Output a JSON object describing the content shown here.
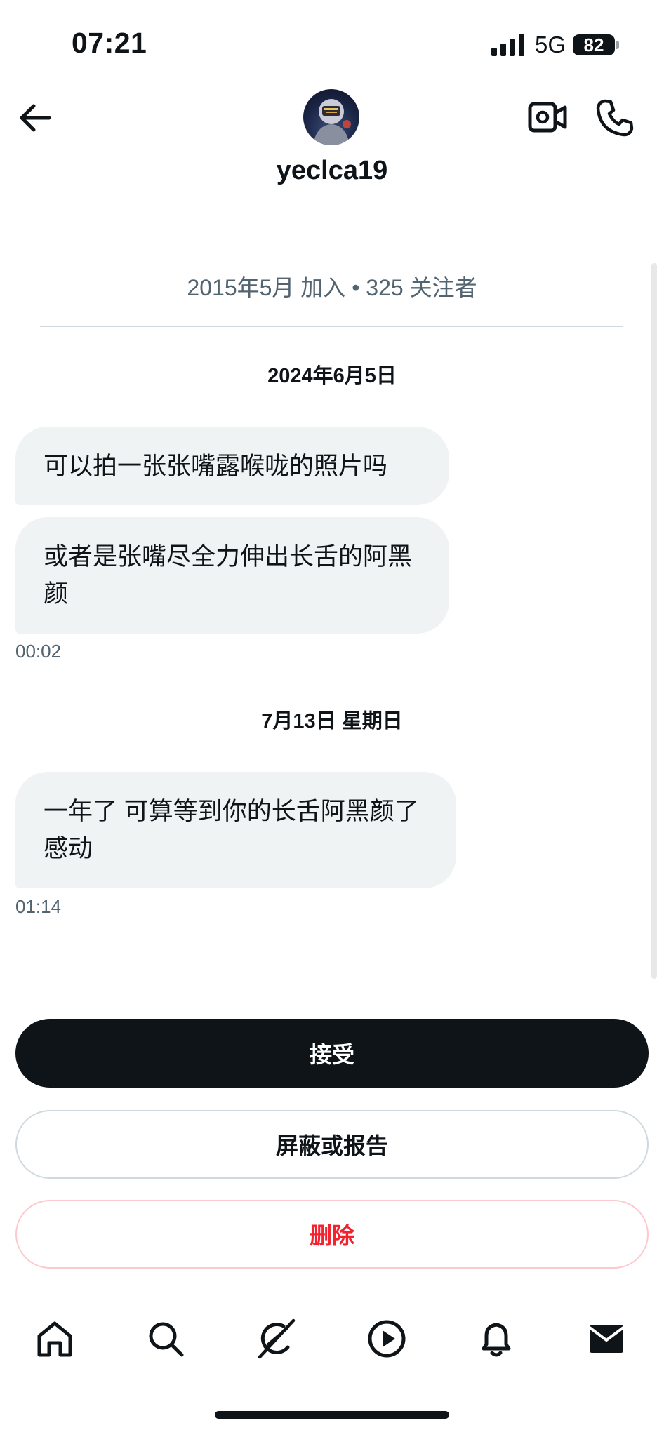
{
  "status_bar": {
    "time": "07:21",
    "network": "5G",
    "battery": "82"
  },
  "header": {
    "username": "yeclca19",
    "joined_info": "2015年5月 加入 • 325 关注者"
  },
  "conversation": [
    {
      "date": "2024年6月5日",
      "messages": [
        {
          "text": "可以拍一张张嘴露喉咙的照片吗"
        },
        {
          "text": "或者是张嘴尽全力伸出长舌的阿黑颜",
          "time": "00:02"
        }
      ]
    },
    {
      "date": "7月13日 星期日",
      "messages": [
        {
          "text": "一年了 可算等到你的长舌阿黑颜了 感动",
          "time": "01:14"
        }
      ]
    }
  ],
  "actions": {
    "accept": "接受",
    "block_or_report": "屏蔽或报告",
    "delete": "删除"
  },
  "colors": {
    "primary_text": "#0f1419",
    "secondary_text": "#536471",
    "bubble_bg": "#eff3f4",
    "accept_bg": "#0f1419",
    "delete_text": "#f4212e",
    "delete_border": "#fdc9ce",
    "border": "#cfd9de"
  },
  "icons": {
    "back": "arrow-left-icon",
    "video": "video-camera-icon",
    "call": "phone-icon",
    "nav": [
      "home-icon",
      "search-icon",
      "grok-icon",
      "play-icon",
      "bell-icon",
      "mail-icon"
    ]
  }
}
